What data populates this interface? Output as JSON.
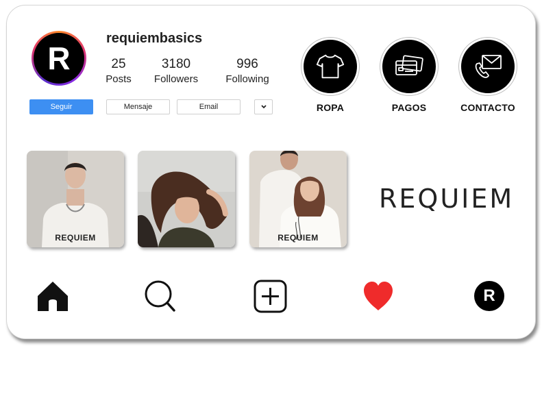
{
  "profile": {
    "username": "requiembasics",
    "avatar_letter": "R",
    "stats": [
      {
        "value": "25",
        "label": "Posts"
      },
      {
        "value": "3180",
        "label": "Followers"
      },
      {
        "value": "996",
        "label": "Following"
      }
    ]
  },
  "actions": {
    "follow": "Seguir",
    "message": "Mensaje",
    "email": "Email",
    "more_icon": "chevron-down-icon"
  },
  "highlights": [
    {
      "label": "ROPA",
      "icon": "tshirt-icon"
    },
    {
      "label": "PAGOS",
      "icon": "credit-cards-icon"
    },
    {
      "label": "CONTACTO",
      "icon": "phone-mail-icon"
    }
  ],
  "posts": [
    {
      "caption": "REQUIEM"
    },
    {
      "caption": ""
    },
    {
      "caption": "REQUIEM"
    }
  ],
  "brand": {
    "wordmark": "REQUIEM"
  },
  "nav": {
    "items": [
      "home-icon",
      "search-icon",
      "add-post-icon",
      "heart-icon",
      "profile-avatar-icon"
    ],
    "profile_letter": "R"
  },
  "colors": {
    "primary": "#3d8ff2",
    "heart": "#ef2b2b",
    "ink": "#000000"
  }
}
